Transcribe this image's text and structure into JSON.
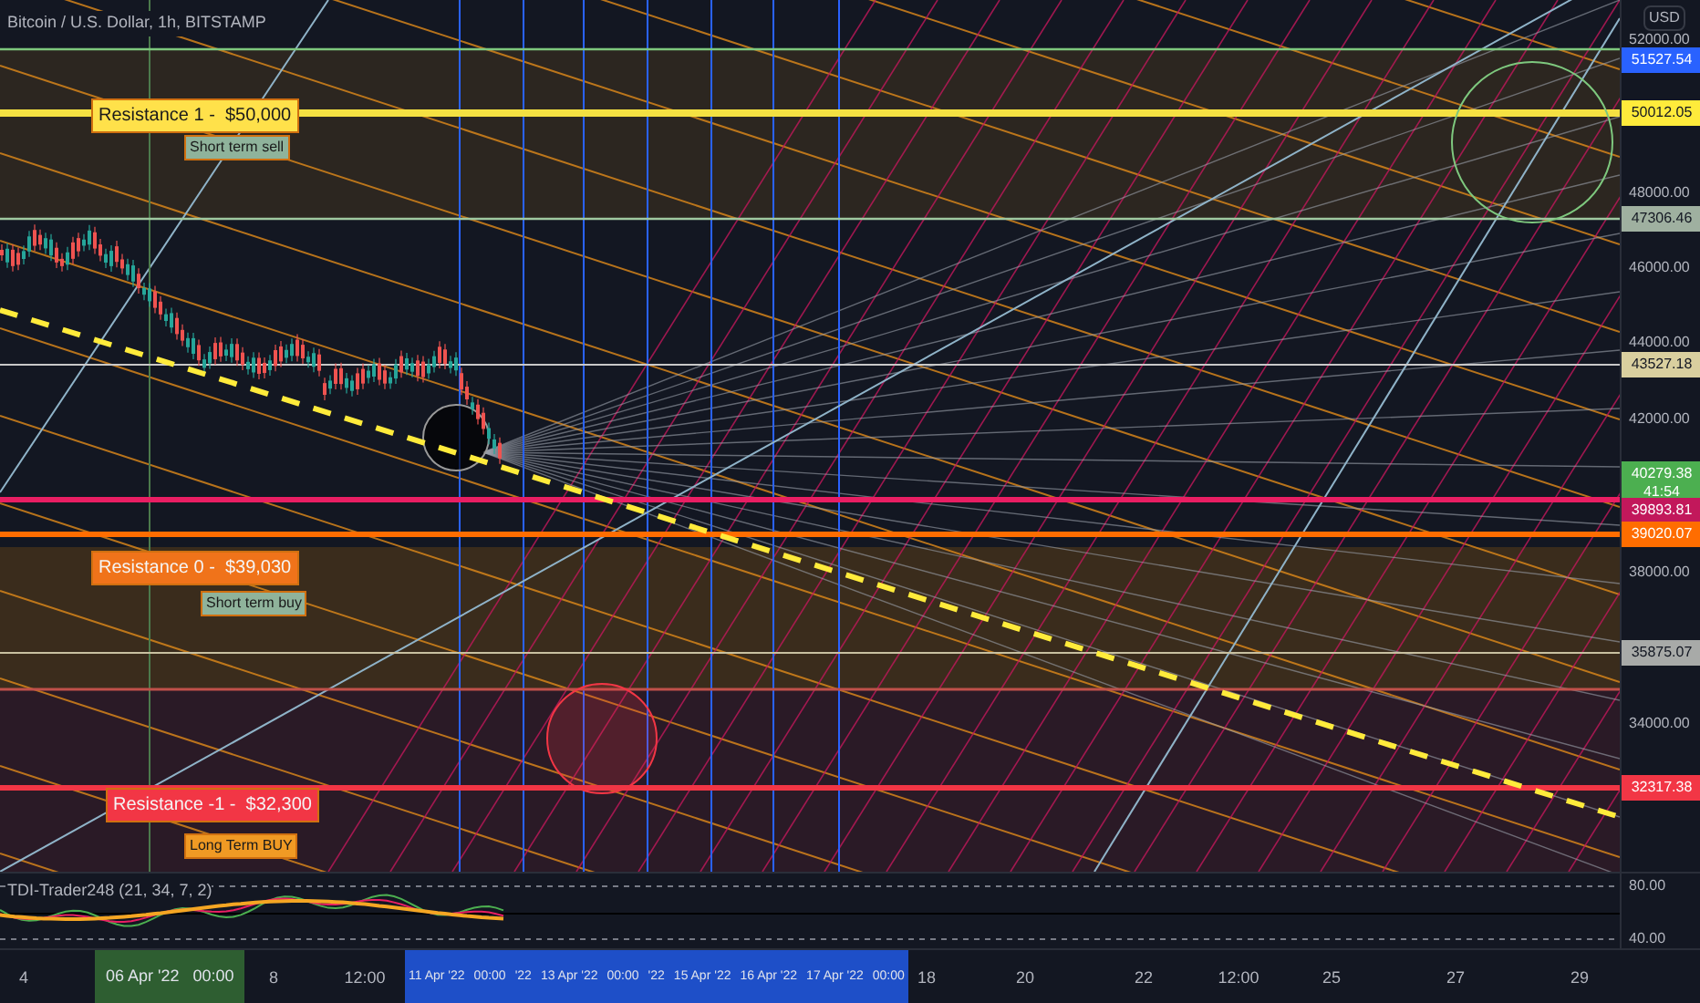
{
  "chart": {
    "title": "Bitcoin / U.S. Dollar, 1h, BITSTAMP",
    "annotations": [
      {
        "text": "Resistance 1 -  $50,000",
        "kind": "level",
        "color": "#ffe14a"
      },
      {
        "text": "Short term sell",
        "kind": "note",
        "color": "#8fb39b"
      },
      {
        "text": "Resistance 0 -  $39,030",
        "kind": "level",
        "color": "#f0731a"
      },
      {
        "text": "Short term buy",
        "kind": "note",
        "color": "#8fb39b"
      },
      {
        "text": "Resistance -1 -  $32,300",
        "kind": "level",
        "color": "#f23645"
      },
      {
        "text": "Long Term BUY",
        "kind": "note",
        "color": "#f09a24"
      }
    ]
  },
  "price_axis": {
    "unit": "USD",
    "labels": [
      {
        "text": "52000.00",
        "kind": "tick"
      },
      {
        "text": "51527.54",
        "kind": "badge",
        "color": "#2962ff"
      },
      {
        "text": "50012.05",
        "kind": "badge",
        "color": "#ffeb3b"
      },
      {
        "text": "48000.00",
        "kind": "tick"
      },
      {
        "text": "47306.46",
        "kind": "badge",
        "color": "#9fb0a0"
      },
      {
        "text": "46000.00",
        "kind": "tick"
      },
      {
        "text": "44000.00",
        "kind": "tick"
      },
      {
        "text": "43527.18",
        "kind": "badge",
        "color": "#d9cf9f"
      },
      {
        "text": "42000.00",
        "kind": "tick"
      },
      {
        "text": "40279.38",
        "subtext": "41:54",
        "kind": "badge",
        "color": "#4caf50"
      },
      {
        "text": "39893.81",
        "kind": "badge",
        "color": "#c2185b"
      },
      {
        "text": "39020.07",
        "kind": "badge",
        "color": "#ff6d00"
      },
      {
        "text": "38000.00",
        "kind": "tick"
      },
      {
        "text": "35875.07",
        "kind": "badge",
        "color": "#a8aaa8"
      },
      {
        "text": "34000.00",
        "kind": "tick"
      },
      {
        "text": "32317.38",
        "kind": "badge",
        "color": "#f23645"
      }
    ]
  },
  "indicator": {
    "title": "TDI-Trader248 (21, 34, 7, 2)",
    "axis_labels": [
      "80.00",
      "40.00"
    ]
  },
  "time_axis": {
    "labels": [
      {
        "text": "4",
        "kind": "tick"
      },
      {
        "text": "06 Apr '22   00:00",
        "kind": "marker"
      },
      {
        "text": "8",
        "kind": "tick"
      },
      {
        "text": "12:00",
        "kind": "tick"
      },
      {
        "text": "11 Apr '22",
        "kind": "range"
      },
      {
        "text": "00:00",
        "kind": "range"
      },
      {
        "text": "'22",
        "kind": "range"
      },
      {
        "text": "13 Apr '22",
        "kind": "range"
      },
      {
        "text": "00:00",
        "kind": "range"
      },
      {
        "text": "'22",
        "kind": "range"
      },
      {
        "text": "15 Apr '22",
        "kind": "range"
      },
      {
        "text": "16 Apr '22",
        "kind": "range"
      },
      {
        "text": "17 Apr '22",
        "kind": "range"
      },
      {
        "text": "00:00",
        "kind": "range"
      },
      {
        "text": "18",
        "kind": "tick"
      },
      {
        "text": "20",
        "kind": "tick"
      },
      {
        "text": "22",
        "kind": "tick"
      },
      {
        "text": "12:00",
        "kind": "tick"
      },
      {
        "text": "25",
        "kind": "tick"
      },
      {
        "text": "27",
        "kind": "tick"
      },
      {
        "text": "29",
        "kind": "tick"
      }
    ]
  }
}
